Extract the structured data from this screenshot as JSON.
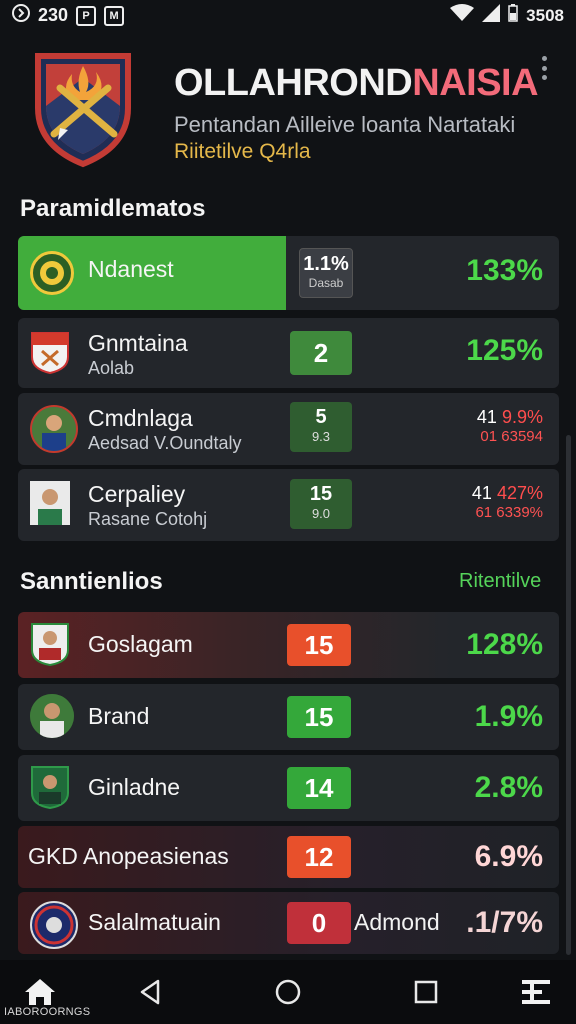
{
  "status_bar": {
    "time": "230",
    "battery_text": "3508"
  },
  "header": {
    "title_main": "OLLAHROND",
    "title_highlight": "NAISIA",
    "subtitle": "Pentandan Ailleive loanta Nartataki",
    "tagline": "Riitetilve Q4rla"
  },
  "section1": {
    "title": "Paramidlematos",
    "rows": [
      {
        "name": "Ndanest",
        "sub": "",
        "stat_top": "1.1%",
        "stat_bottom": "Dasab",
        "pct": "133%"
      },
      {
        "name": "Gnmtaina",
        "sub": "Aolab",
        "stat": "2",
        "pct": "125%"
      },
      {
        "name": "Cmdnlaga",
        "sub": "Aedsad V.Oundtaly",
        "stat_top": "5",
        "stat_bottom": "9.3",
        "duo_top_white": "41",
        "duo_top_red": "9.9%",
        "duo_bottom": "01 63594"
      },
      {
        "name": "Cerpaliey",
        "sub": "Rasane Cotohj",
        "stat_top": "15",
        "stat_bottom": "9.0",
        "duo_top_white": "41",
        "duo_top_red": "427%",
        "duo_bottom": "61 6339%"
      }
    ]
  },
  "section2": {
    "title": "Sanntienlios",
    "link": "Ritentilve",
    "rows": [
      {
        "name": "Goslagam",
        "stat": "15",
        "pct": "128%"
      },
      {
        "name": "Brand",
        "stat": "15",
        "pct": "1.9%"
      },
      {
        "name": "Ginladne",
        "stat": "14",
        "pct": "2.8%"
      },
      {
        "name": "GKD Anopeasienas",
        "stat": "12",
        "pct": "6.9%"
      },
      {
        "name": "Salalmatuain",
        "stat": "0",
        "extra": "Admond",
        "pct": ".1/7%"
      }
    ]
  },
  "nav": {
    "home_label": "IABOROORNGS"
  },
  "colors": {
    "background": "#101215",
    "accent_green": "#41ad3c",
    "accent_red": "#e8502b",
    "title_highlight": "#f36b7a",
    "tagline": "#e5b84a"
  },
  "icons": {
    "crest": "crest-shield-icon",
    "menu": "kebab-menu-icon",
    "nav": [
      "home-icon",
      "back-icon",
      "circle-home-icon",
      "recents-icon",
      "menu-lines-icon"
    ]
  }
}
